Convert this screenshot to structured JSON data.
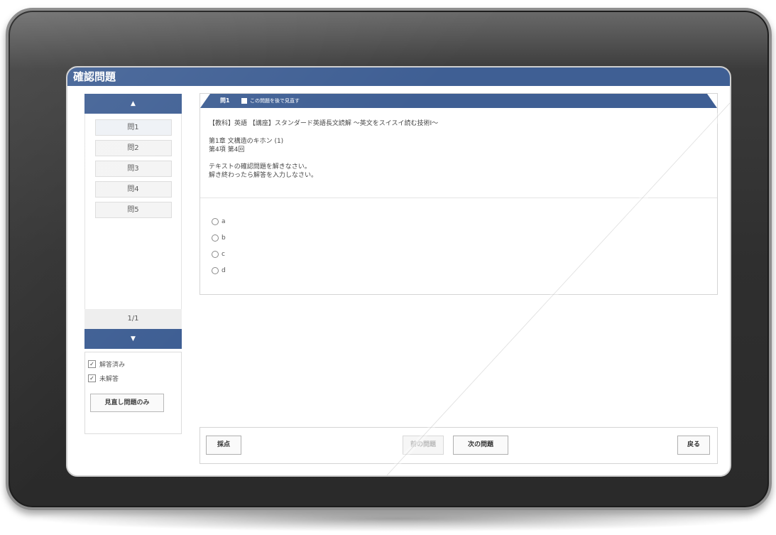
{
  "app": {
    "title": "確認問題"
  },
  "nav": {
    "up_icon": "▲",
    "down_icon": "▼",
    "page_indicator": "1/1"
  },
  "question_list": [
    {
      "label": "問1"
    },
    {
      "label": "問2"
    },
    {
      "label": "問3"
    },
    {
      "label": "問4"
    },
    {
      "label": "問5"
    }
  ],
  "filters": {
    "answered": {
      "label": "解答済み",
      "checked": true,
      "mark": "✓"
    },
    "unanswered": {
      "label": "未解答",
      "checked": true,
      "mark": "✓"
    },
    "marked_only_button": "見直し問題のみ"
  },
  "question": {
    "number": "問1",
    "review_label": "この問題を後で見直す",
    "course": "【教科】英語 【講座】スタンダード英語長文読解 ～英文をスイスイ読む技術Ⅰ～",
    "chapter": "第1章 文構造のキホン (1)",
    "item": "第4項 第4回",
    "instruction_1": "テキストの確認問題を解きなさい。",
    "instruction_2": "解き終わったら解答を入力しなさい。",
    "options": [
      "a",
      "b",
      "c",
      "d"
    ]
  },
  "buttons": {
    "grade": "採点",
    "prev": "前の問題",
    "next": "次の問題",
    "back": "戻る"
  },
  "colors": {
    "header": "#3f5f94",
    "device": "#2f2f2f"
  }
}
